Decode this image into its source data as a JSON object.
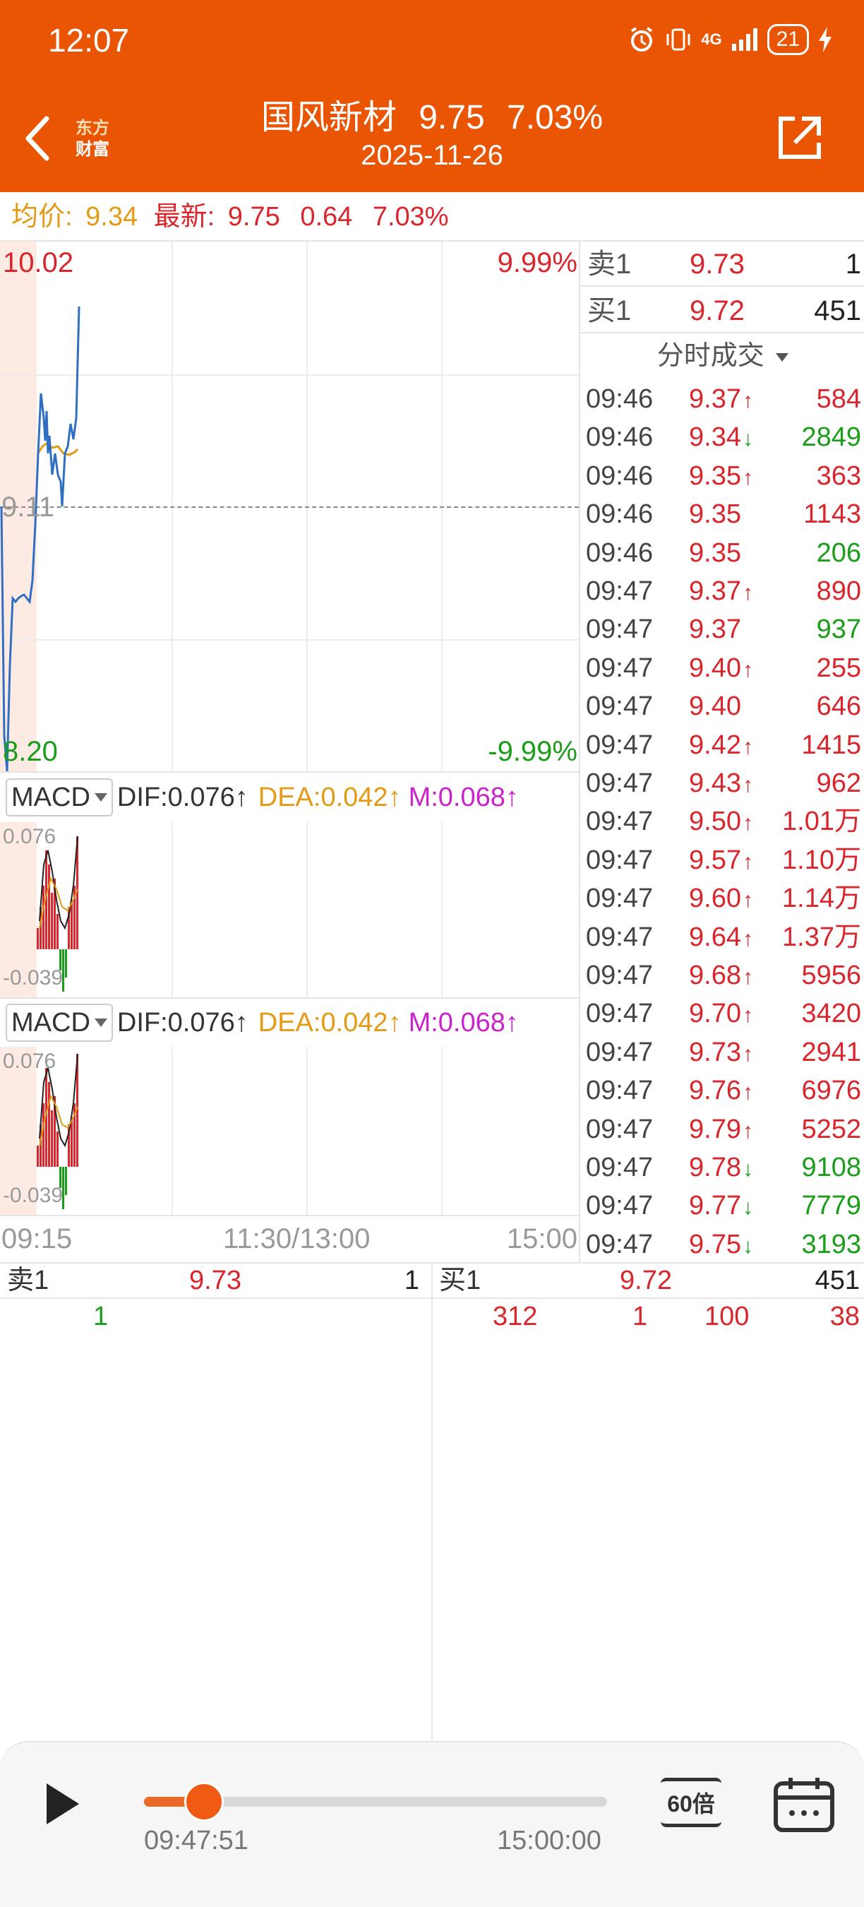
{
  "status_bar": {
    "time": "12:07",
    "network": "4G",
    "battery": "21"
  },
  "header": {
    "logo_line1": "东方",
    "logo_line2": "财富",
    "stock_name": "国风新材",
    "price": "9.75",
    "change_pct": "7.03%",
    "date": "2025-11-26"
  },
  "info_bar": {
    "avg_label": "均价:",
    "avg_value": "9.34",
    "latest_label": "最新:",
    "latest_value": "9.75",
    "change": "0.64",
    "change_pct": "7.03%"
  },
  "price_chart": {
    "top_price": "10.02",
    "top_pct": "9.99%",
    "mid_price": "9.11",
    "bottom_price": "8.20",
    "bottom_pct": "-9.99%"
  },
  "macd_panels": [
    {
      "indicator": "MACD",
      "dif": "DIF:0.076",
      "dea": "DEA:0.042",
      "m": "M:0.068",
      "top_val": "0.076",
      "bottom_val": "-0.039"
    },
    {
      "indicator": "MACD",
      "dif": "DIF:0.076",
      "dea": "DEA:0.042",
      "m": "M:0.068",
      "top_val": "0.076",
      "bottom_val": "-0.039"
    }
  ],
  "time_axis": {
    "start": "09:15",
    "mid": "11:30/13:00",
    "end": "15:00"
  },
  "quote": {
    "sell1_label": "卖1",
    "sell1_price": "9.73",
    "sell1_vol": "1",
    "buy1_label": "买1",
    "buy1_price": "9.72",
    "buy1_vol": "451"
  },
  "trades_title": "分时成交",
  "trades": [
    {
      "time": "09:46",
      "price": "9.37",
      "dir": "up",
      "vol": "584",
      "vol_color": "red"
    },
    {
      "time": "09:46",
      "price": "9.34",
      "dir": "down",
      "vol": "2849",
      "vol_color": "green"
    },
    {
      "time": "09:46",
      "price": "9.35",
      "dir": "up",
      "vol": "363",
      "vol_color": "red"
    },
    {
      "time": "09:46",
      "price": "9.35",
      "dir": "",
      "vol": "1143",
      "vol_color": "red"
    },
    {
      "time": "09:46",
      "price": "9.35",
      "dir": "",
      "vol": "206",
      "vol_color": "green"
    },
    {
      "time": "09:47",
      "price": "9.37",
      "dir": "up",
      "vol": "890",
      "vol_color": "red"
    },
    {
      "time": "09:47",
      "price": "9.37",
      "dir": "",
      "vol": "937",
      "vol_color": "green"
    },
    {
      "time": "09:47",
      "price": "9.40",
      "dir": "up",
      "vol": "255",
      "vol_color": "red"
    },
    {
      "time": "09:47",
      "price": "9.40",
      "dir": "",
      "vol": "646",
      "vol_color": "red"
    },
    {
      "time": "09:47",
      "price": "9.42",
      "dir": "up",
      "vol": "1415",
      "vol_color": "red"
    },
    {
      "time": "09:47",
      "price": "9.43",
      "dir": "up",
      "vol": "962",
      "vol_color": "red"
    },
    {
      "time": "09:47",
      "price": "9.50",
      "dir": "up",
      "vol": "1.01万",
      "vol_color": "red"
    },
    {
      "time": "09:47",
      "price": "9.57",
      "dir": "up",
      "vol": "1.10万",
      "vol_color": "red"
    },
    {
      "time": "09:47",
      "price": "9.60",
      "dir": "up",
      "vol": "1.14万",
      "vol_color": "red"
    },
    {
      "time": "09:47",
      "price": "9.64",
      "dir": "up",
      "vol": "1.37万",
      "vol_color": "red"
    },
    {
      "time": "09:47",
      "price": "9.68",
      "dir": "up",
      "vol": "5956",
      "vol_color": "red"
    },
    {
      "time": "09:47",
      "price": "9.70",
      "dir": "up",
      "vol": "3420",
      "vol_color": "red"
    },
    {
      "time": "09:47",
      "price": "9.73",
      "dir": "up",
      "vol": "2941",
      "vol_color": "red"
    },
    {
      "time": "09:47",
      "price": "9.76",
      "dir": "up",
      "vol": "6976",
      "vol_color": "red"
    },
    {
      "time": "09:47",
      "price": "9.79",
      "dir": "up",
      "vol": "5252",
      "vol_color": "red"
    },
    {
      "time": "09:47",
      "price": "9.78",
      "dir": "down",
      "vol": "9108",
      "vol_color": "green"
    },
    {
      "time": "09:47",
      "price": "9.77",
      "dir": "down",
      "vol": "7779",
      "vol_color": "green"
    },
    {
      "time": "09:47",
      "price": "9.75",
      "dir": "down",
      "vol": "3193",
      "vol_color": "green"
    }
  ],
  "order_book": {
    "sell_label": "卖1",
    "sell_price": "9.73",
    "sell_vol": "1",
    "sell_queue": [
      "1"
    ],
    "buy_label": "买1",
    "buy_price": "9.72",
    "buy_vol": "451",
    "buy_queue": [
      "312",
      "1",
      "100",
      "38"
    ]
  },
  "player": {
    "current_time": "09:47:51",
    "end_time": "15:00:00",
    "progress": 0.13,
    "speed_label": "60倍"
  },
  "colors": {
    "brand_orange": "#ea5504",
    "up_red": "#d9262c",
    "down_green": "#1a9e1a",
    "avg_orange": "#e49a14",
    "price_line_blue": "#2f6fc2"
  }
}
